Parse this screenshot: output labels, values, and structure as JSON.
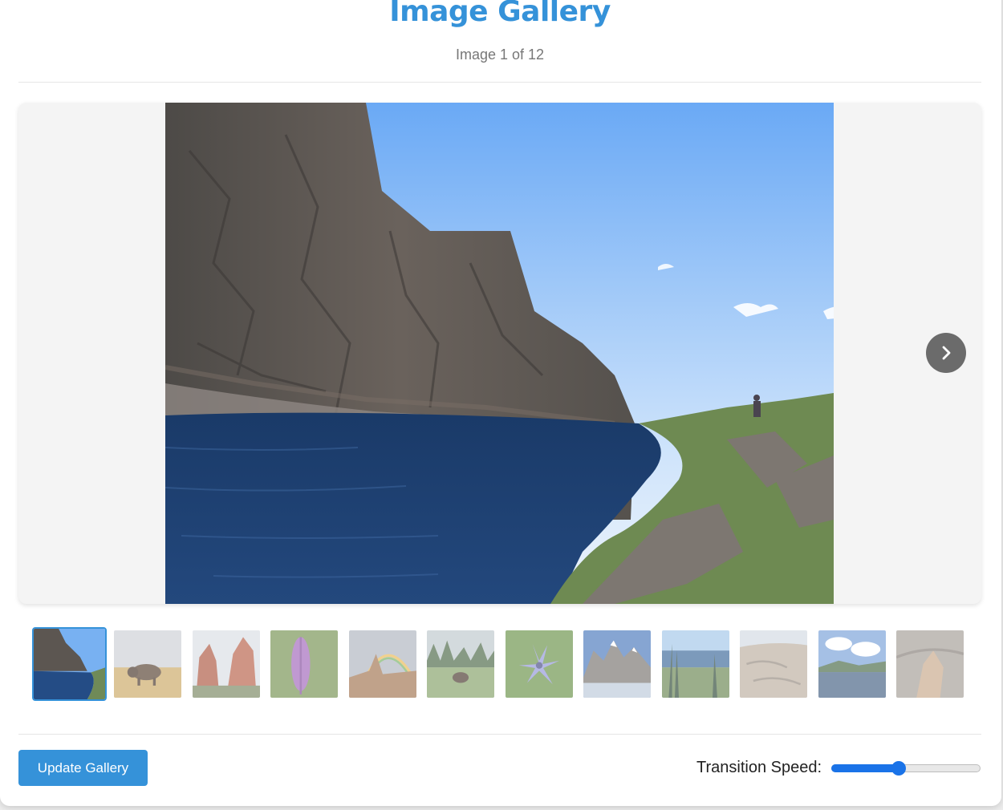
{
  "header": {
    "title": "Image Gallery",
    "counter": "Image 1 of 12"
  },
  "viewer": {
    "main_image_icon": "mountain-lake-photo",
    "next_icon": "chevron-right-icon"
  },
  "thumbnails": [
    {
      "icon": "mountain-lake-thumb",
      "active": true
    },
    {
      "icon": "bison-thumb",
      "active": false
    },
    {
      "icon": "red-rocks-thumb",
      "active": false
    },
    {
      "icon": "purple-flower-thumb",
      "active": false
    },
    {
      "icon": "rainbow-canyon-thumb",
      "active": false
    },
    {
      "icon": "moose-meadow-thumb",
      "active": false
    },
    {
      "icon": "blue-flower-thumb",
      "active": false
    },
    {
      "icon": "alpine-lake-thumb",
      "active": false
    },
    {
      "icon": "pine-lake-thumb",
      "active": false
    },
    {
      "icon": "rocky-terrain-thumb",
      "active": false
    },
    {
      "icon": "cloudy-lake-thumb",
      "active": false
    },
    {
      "icon": "rocky-hoodoo-thumb",
      "active": false
    }
  ],
  "footer": {
    "update_label": "Update Gallery",
    "speed_label": "Transition Speed:",
    "speed_value": 0.45
  },
  "colors": {
    "accent": "#3592d9",
    "slider": "#1a73e8"
  }
}
